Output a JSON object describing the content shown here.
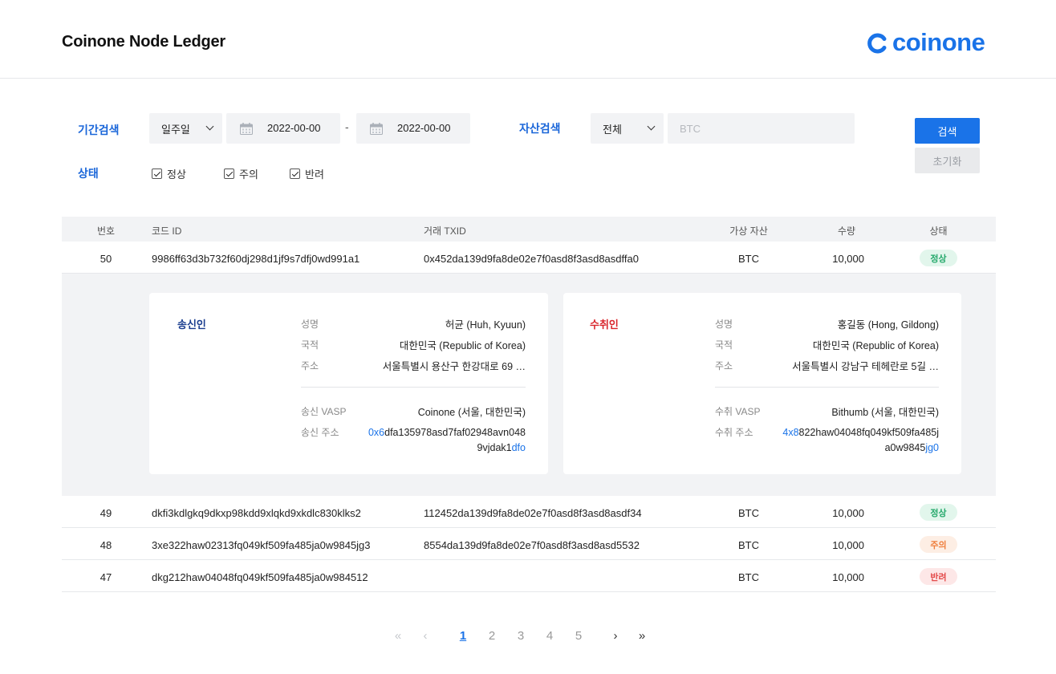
{
  "header": {
    "title": "Coinone Node Ledger",
    "logo_text": "coinone",
    "brand_color": "#1a73e8"
  },
  "filters": {
    "period_label": "기간검색",
    "period_select": "일주일",
    "date_from": "2022-00-00",
    "date_to": "2022-00-00",
    "date_separator": "-",
    "asset_label": "자산검색",
    "asset_select": "전체",
    "asset_placeholder": "BTC",
    "status_label": "상태",
    "status_options": [
      {
        "label": "정상",
        "checked": true
      },
      {
        "label": "주의",
        "checked": true
      },
      {
        "label": "반려",
        "checked": true
      }
    ],
    "search_button": "검색",
    "reset_button": "초기화"
  },
  "table": {
    "headers": {
      "num": "번호",
      "code": "코드 ID",
      "txid": "거래 TXID",
      "asset": "가상 자산",
      "qty": "수량",
      "status": "상태"
    },
    "rows": [
      {
        "num": "50",
        "code": "9986ff63d3b732f60dj298d1jf9s7dfj0wd991a1",
        "txid": "0x452da139d9fa8de02e7f0asd8f3asd8asdffa0",
        "asset": "BTC",
        "qty": "10,000",
        "status": "정상",
        "status_type": "normal"
      },
      {
        "num": "49",
        "code": "dkfi3kdlgkq9dkxp98kdd9xlqkd9xkdlc830klks2",
        "txid": "112452da139d9fa8de02e7f0asd8f3asd8asdf34",
        "asset": "BTC",
        "qty": "10,000",
        "status": "정상",
        "status_type": "normal"
      },
      {
        "num": "48",
        "code": "3xe322haw02313fq049kf509fa485ja0w9845jg3",
        "txid": "8554da139d9fa8de02e7f0asd8f3asd8asd5532",
        "asset": "BTC",
        "qty": "10,000",
        "status": "주의",
        "status_type": "warn"
      },
      {
        "num": "47",
        "code": "dkg212haw04048fq049kf509fa485ja0w984512",
        "txid": "",
        "asset": "BTC",
        "qty": "10,000",
        "status": "반려",
        "status_type": "reject"
      }
    ]
  },
  "detail": {
    "sender": {
      "title": "송신인",
      "name_key": "성명",
      "name": "허균 (Huh, Kyuun)",
      "nation_key": "국적",
      "nation": "대한민국 (Republic of Korea)",
      "address_key": "주소",
      "address": "서울특별시 용산구 한강대로 69 …",
      "vasp_key": "송신 VASP",
      "vasp": "Coinone (서울, 대한민국)",
      "wallet_key": "송신 주소",
      "wallet_head": "0x6",
      "wallet_mid": "dfa135978asd7faf02948avn0489vjdak1",
      "wallet_tail": "dfo"
    },
    "receiver": {
      "title": "수취인",
      "name_key": "성명",
      "name": "홍길동 (Hong, Gildong)",
      "nation_key": "국적",
      "nation": "대한민국 (Republic of Korea)",
      "address_key": "주소",
      "address": "서울특별시 강남구 테헤란로 5길 …",
      "vasp_key": "수취 VASP",
      "vasp": "Bithumb (서울, 대한민국)",
      "wallet_key": "수취 주소",
      "wallet_head": "4x8",
      "wallet_mid": "822haw04048fq049kf509fa485ja0w9845",
      "wallet_tail": "jg0"
    }
  },
  "pagination": {
    "first": "«",
    "prev": "‹",
    "pages": [
      "1",
      "2",
      "3",
      "4",
      "5"
    ],
    "current": "1",
    "next": "›",
    "last": "»"
  },
  "colors": {
    "accent": "#1a73e8",
    "normal": "#26a96c",
    "warn": "#ef7d3b",
    "reject": "#e44b4b",
    "sender_title": "#1a3d8f",
    "receiver_title": "#d9262c"
  }
}
